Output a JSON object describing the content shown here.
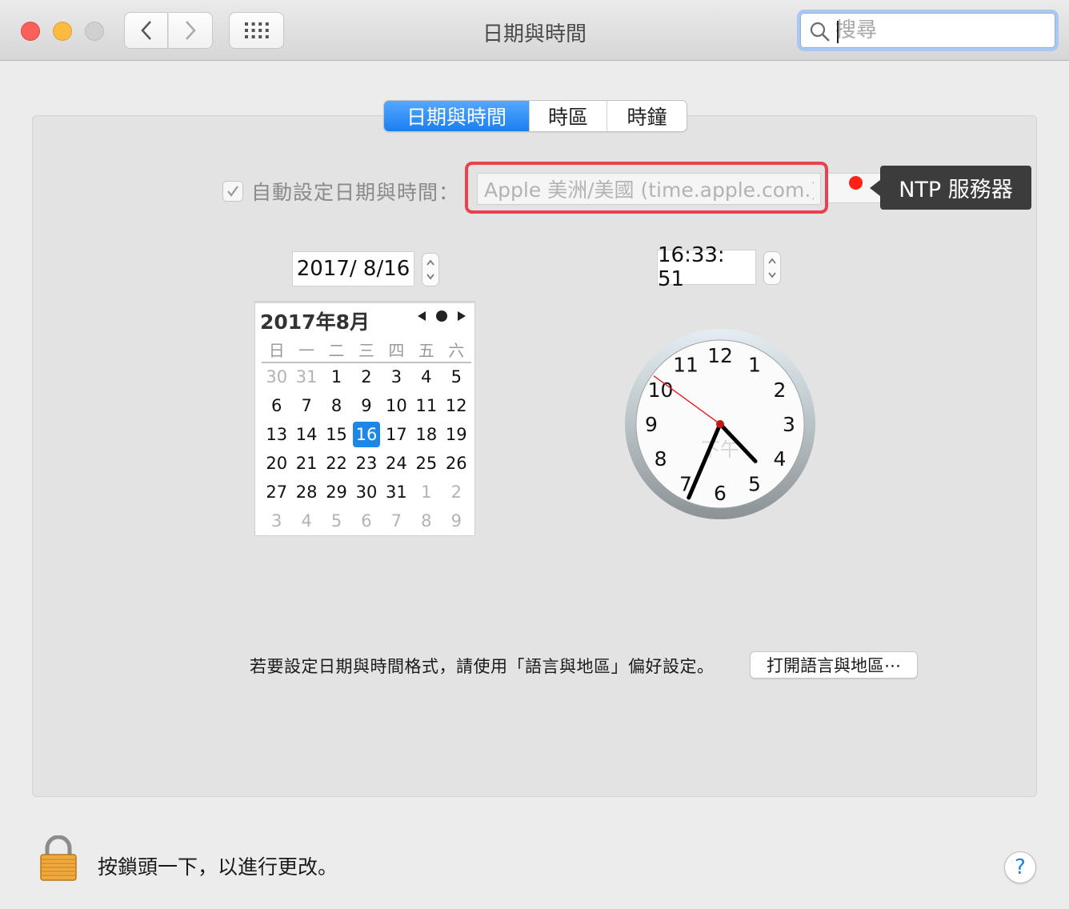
{
  "window": {
    "title": "日期與時間"
  },
  "search": {
    "placeholder": "搜尋"
  },
  "tabs": [
    {
      "label": "日期與時間",
      "selected": true
    },
    {
      "label": "時區",
      "selected": false
    },
    {
      "label": "時鐘",
      "selected": false
    }
  ],
  "auto_set": {
    "label": "自動設定日期與時間：",
    "checked": true
  },
  "ntp": {
    "server": "Apple 美洲/美國 (time.apple.com.)",
    "tooltip": "NTP 服務器",
    "status_color": "#ff2116"
  },
  "date_field": {
    "value": "2017/  8/16"
  },
  "time_field": {
    "value": "16:33: 51"
  },
  "calendar": {
    "header": "2017年8月",
    "weekdays": [
      "日",
      "一",
      "二",
      "三",
      "四",
      "五",
      "六"
    ],
    "days": [
      {
        "d": "30",
        "other": true
      },
      {
        "d": "31",
        "other": true
      },
      {
        "d": "1"
      },
      {
        "d": "2"
      },
      {
        "d": "3"
      },
      {
        "d": "4"
      },
      {
        "d": "5"
      },
      {
        "d": "6"
      },
      {
        "d": "7"
      },
      {
        "d": "8"
      },
      {
        "d": "9"
      },
      {
        "d": "10"
      },
      {
        "d": "11"
      },
      {
        "d": "12"
      },
      {
        "d": "13"
      },
      {
        "d": "14"
      },
      {
        "d": "15"
      },
      {
        "d": "16",
        "selected": true
      },
      {
        "d": "17"
      },
      {
        "d": "18"
      },
      {
        "d": "19"
      },
      {
        "d": "20"
      },
      {
        "d": "21"
      },
      {
        "d": "22"
      },
      {
        "d": "23"
      },
      {
        "d": "24"
      },
      {
        "d": "25"
      },
      {
        "d": "26"
      },
      {
        "d": "27"
      },
      {
        "d": "28"
      },
      {
        "d": "29"
      },
      {
        "d": "30"
      },
      {
        "d": "31"
      },
      {
        "d": "1",
        "other": true
      },
      {
        "d": "2",
        "other": true
      },
      {
        "d": "3",
        "other": true
      },
      {
        "d": "4",
        "other": true
      },
      {
        "d": "5",
        "other": true
      },
      {
        "d": "6",
        "other": true
      },
      {
        "d": "7",
        "other": true
      },
      {
        "d": "8",
        "other": true
      },
      {
        "d": "9",
        "other": true
      }
    ]
  },
  "clock": {
    "numbers": [
      "12",
      "1",
      "2",
      "3",
      "4",
      "5",
      "6",
      "7",
      "8",
      "9",
      "10",
      "11"
    ],
    "meridiem": "下午",
    "hour": 4,
    "minute": 33,
    "second": 51
  },
  "format_note": "若要設定日期與時間格式，請使用「語言與地區」偏好設定。",
  "open_button": "打開語言與地區⋯",
  "lock_text": "按鎖頭一下，以進行更改。",
  "help_label": "?",
  "colors": {
    "accent": "#1f86e9",
    "highlight": "#e8424f"
  }
}
